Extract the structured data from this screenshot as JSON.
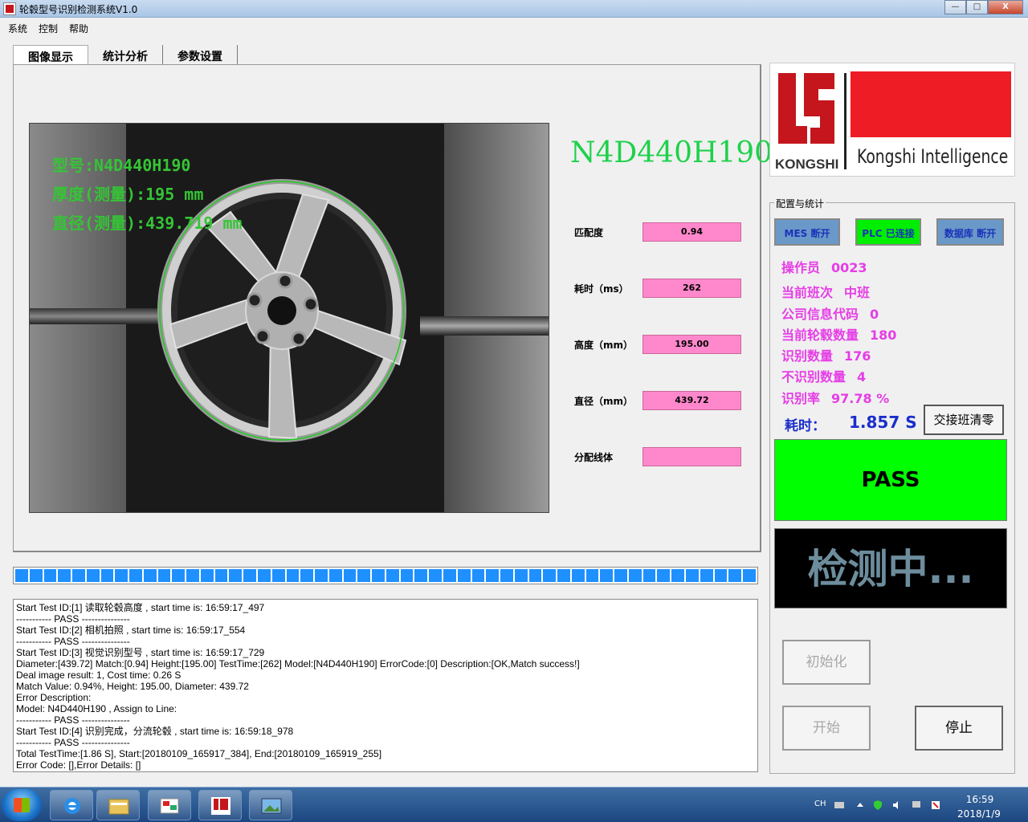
{
  "window": {
    "title": "轮毂型号识别检测系统V1.0",
    "min_label": "—",
    "max_label": "□",
    "close_label": "X"
  },
  "menu": [
    "系统",
    "控制",
    "帮助"
  ],
  "tabs": [
    "图像显示",
    "统计分析",
    "参数设置"
  ],
  "camera": {
    "overlay_model": "型号:N4D440H190",
    "overlay_thickness": "厚度(测量):195 mm",
    "overlay_diameter": "直径(测量):439.719 mm"
  },
  "model_code": "N4D440H190",
  "measurements": [
    {
      "label": "匹配度",
      "value": "0.94"
    },
    {
      "label": "耗时（ms）",
      "value": "262"
    },
    {
      "label": "高度（mm）",
      "value": "195.00"
    },
    {
      "label": "直径（mm）",
      "value": "439.72"
    },
    {
      "label": "分配线体",
      "value": ""
    }
  ],
  "progress": {
    "filled_fraction": 1.0,
    "blocks": 52
  },
  "log_lines": [
    "Start Test ID:[1] 读取轮毂高度 , start time is: 16:59:17_497",
    "----------- PASS ---------------",
    "Start Test ID:[2] 相机拍照 , start time is: 16:59:17_554",
    "----------- PASS ---------------",
    "Start Test ID:[3] 视觉识别型号 , start time is: 16:59:17_729",
    "Diameter:[439.72] Match:[0.94] Height:[195.00] TestTime:[262] Model:[N4D440H190] ErrorCode:[0] Description:[OK,Match success!]",
    "Deal image result: 1, Cost time: 0.26 S",
    "Match Value: 0.94%, Height: 195.00, Diameter: 439.72",
    "Error Description:",
    "Model: N4D440H190 , Assign to Line:",
    "----------- PASS ---------------",
    "Start Test ID:[4] 识别完成，分流轮毂 , start time is: 16:59:18_978",
    "----------- PASS ---------------",
    "Total TestTime:[1.86 S], Start:[20180109_165917_384], End:[20180109_165919_255]",
    "Error Code: [],Error Details: []"
  ],
  "logo": {
    "wordmark": "KONGSHI",
    "english": "Kongshi Intelligence"
  },
  "config": {
    "legend": "配置与统计",
    "status_buttons": [
      {
        "label": "MES 断开",
        "state": "disconnected"
      },
      {
        "label": "PLC 已连接",
        "state": "connected"
      },
      {
        "label": "数据库 断开",
        "state": "disconnected"
      }
    ],
    "stats": [
      {
        "label": "操作员",
        "value": "0023"
      },
      {
        "label": "当前班次",
        "value": "中班"
      },
      {
        "label": "公司信息代码",
        "value": "0"
      },
      {
        "label": "当前轮毂数量",
        "value": "180"
      },
      {
        "label": "识别数量",
        "value": "176"
      },
      {
        "label": "不识别数量",
        "value": "4"
      },
      {
        "label": "识别率",
        "value": "97.78 %"
      }
    ],
    "time_label": "耗时：",
    "time_value": "1.857 S",
    "shift_reset_label": "交接班清零",
    "result": "PASS",
    "status_text": "检测中...",
    "init_label": "初始化",
    "start_label": "开始",
    "stop_label": "停止"
  },
  "taskbar": {
    "ime": "CH",
    "time": "16:59",
    "date": "2018/1/9"
  },
  "colors": {
    "pass": "#00ff00",
    "meas_bg": "#ff88cc",
    "model_green": "#1ed14b",
    "stat_magenta": "#e63de6",
    "time_blue": "#1a2ecc"
  }
}
